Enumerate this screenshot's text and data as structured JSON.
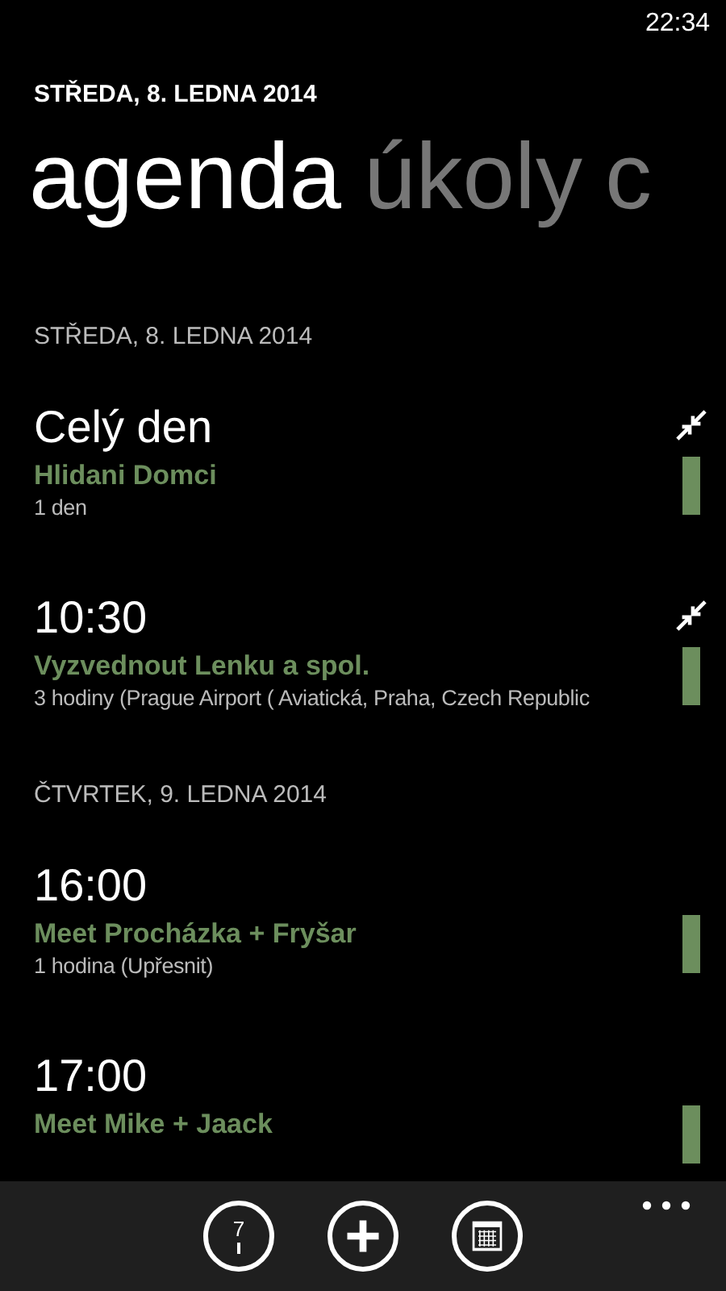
{
  "status_bar": {
    "time": "22:34"
  },
  "date_header": "STŘEDA, 8. LEDNA 2014",
  "pivot": [
    {
      "label": "agenda",
      "selected": true
    },
    {
      "label": "úkoly",
      "selected": false
    },
    {
      "label": "c",
      "selected": false
    }
  ],
  "days": [
    {
      "heading": "STŘEDA, 8. LEDNA 2014",
      "events": [
        {
          "time": "Celý den",
          "title": "Hlidani Domci",
          "detail": "1 den",
          "conflict": true
        },
        {
          "time": "10:30",
          "title": "Vyzvednout Lenku a spol.",
          "detail": "3 hodiny (Prague Airport ( Aviatická, Praha, Czech Republic",
          "conflict": true
        }
      ]
    },
    {
      "heading": "ČTVRTEK, 9. LEDNA 2014",
      "events": [
        {
          "time": "16:00",
          "title": "Meet Procházka + Fryšar",
          "detail": "1 hodina (Upřesnit)",
          "conflict": false
        },
        {
          "time": "17:00",
          "title": "Meet Mike + Jaack",
          "conflict": false
        }
      ]
    }
  ],
  "app_bar": {
    "today_label": "7"
  }
}
